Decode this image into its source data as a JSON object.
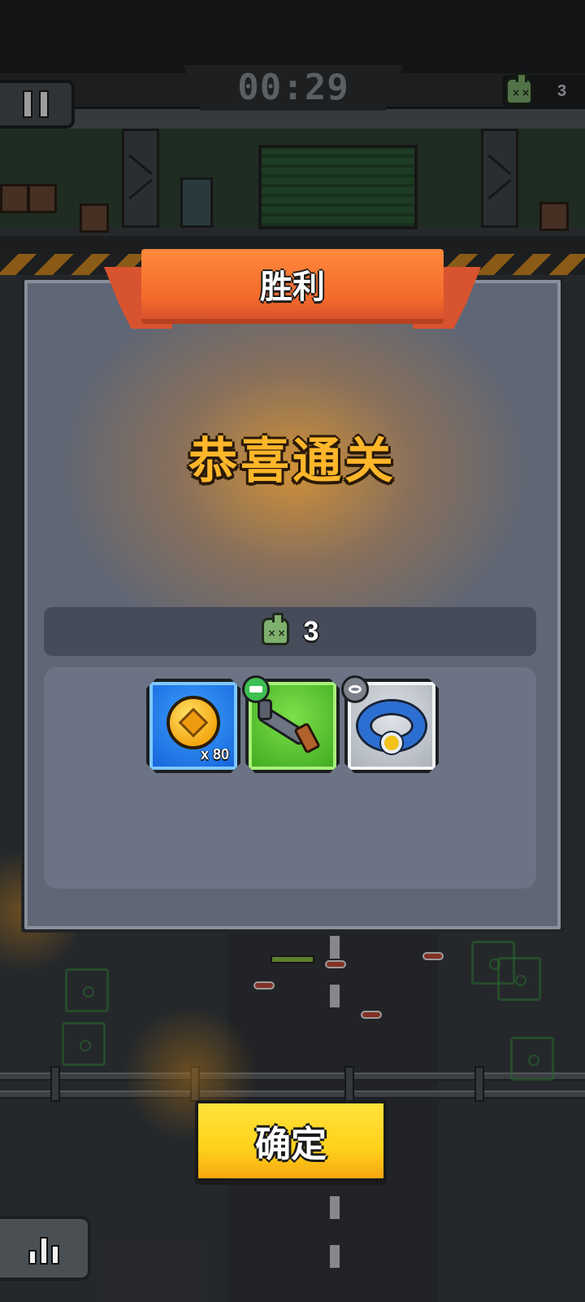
{
  "hud": {
    "timer": "00:29",
    "kill_count": "3"
  },
  "dialog": {
    "ribbon_title": "胜利",
    "headline": "恭喜通关",
    "kills": "3",
    "rewards": [
      {
        "type": "coin",
        "icon": "coin-icon",
        "quantity": "x 80",
        "rarity_color": "#1E6EE8"
      },
      {
        "type": "weapon",
        "icon": "pistol-icon",
        "badge_icon": "weapon-category-icon",
        "rarity_color": "#49C02A"
      },
      {
        "type": "collar",
        "icon": "collar-icon",
        "badge_icon": "collar-category-icon",
        "rarity_color": "#B9BFC7"
      }
    ]
  },
  "buttons": {
    "confirm": "确定"
  },
  "colors": {
    "ribbon": "#F36A2A",
    "headline": "#FFB62A",
    "confirm_button": "#FFD21C",
    "panel": "#5F6675"
  }
}
